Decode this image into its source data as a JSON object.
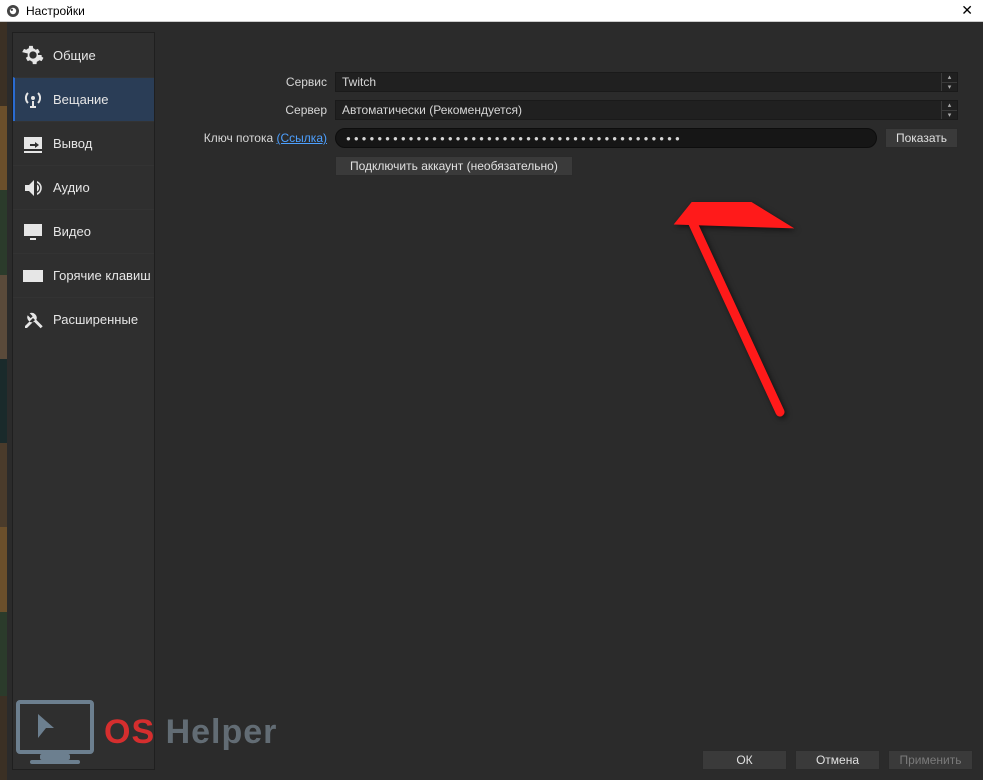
{
  "window": {
    "title": "Настройки"
  },
  "sidebar": {
    "items": [
      {
        "id": "general",
        "label": "Общие"
      },
      {
        "id": "stream",
        "label": "Вещание",
        "selected": true
      },
      {
        "id": "output",
        "label": "Вывод"
      },
      {
        "id": "audio",
        "label": "Аудио"
      },
      {
        "id": "video",
        "label": "Видео"
      },
      {
        "id": "hotkeys",
        "label": "Горячие клавиш"
      },
      {
        "id": "advanced",
        "label": "Расширенные"
      }
    ]
  },
  "stream": {
    "service_label": "Сервис",
    "service_value": "Twitch",
    "server_label": "Сервер",
    "server_value": "Автоматически (Рекомендуется)",
    "streamkey_label": "Ключ потока",
    "streamkey_link": "(Ссылка)",
    "streamkey_masked": "●●●●●●●●●●●●●●●●●●●●●●●●●●●●●●●●●●●●●●●●●●●",
    "show_button": "Показать",
    "connect_account": "Подключить аккаунт (необязательно)"
  },
  "dialog": {
    "ok": "ОК",
    "cancel": "Отмена",
    "apply": "Применить"
  },
  "watermark": {
    "text1": "OS ",
    "text2": "Helper"
  },
  "colors": {
    "arrow": "#ff1a1a",
    "selected_bg": "#2a3d56"
  }
}
